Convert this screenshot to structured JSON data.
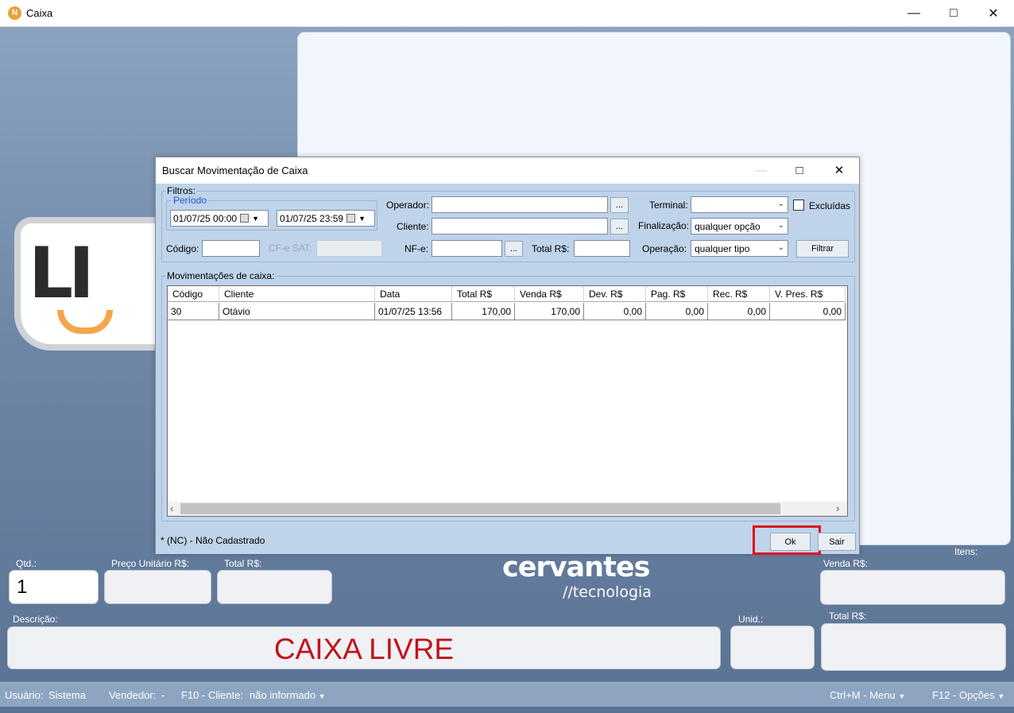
{
  "window": {
    "title": "Caixa",
    "app_icon_letter": "N"
  },
  "dialog": {
    "title": "Buscar Movimentação de Caixa",
    "filters_label": "Filtros:",
    "period_label": "Período",
    "date_from": "01/07/25 00:00",
    "date_to": "01/07/25 23:59",
    "operador_label": "Operador:",
    "operador_value": "",
    "cliente_label": "Cliente:",
    "cliente_value": "",
    "browse_label": "...",
    "terminal_label": "Terminal:",
    "terminal_value": "",
    "excluidas_label": "Excluídas",
    "finalizacao_label": "Finalização:",
    "finalizacao_value": "qualquer opção",
    "codigo_label": "Código:",
    "codigo_value": "",
    "cfe_sat_label": "CF-e SAT:",
    "nfe_label": "NF-e:",
    "total_label": "Total R$:",
    "operacao_label": "Operação:",
    "operacao_value": "qualquer tipo",
    "filtrar_label": "Filtrar",
    "movimentacoes_label": "Movimentações de caixa:",
    "columns": [
      "Código",
      "Cliente",
      "Data",
      "Total R$",
      "Venda R$",
      "Dev. R$",
      "Pag. R$",
      "Rec. R$",
      "V. Pres. R$"
    ],
    "rows": [
      [
        "30",
        "Otávio",
        "01/07/25 13:56",
        "170,00",
        "170,00",
        "0,00",
        "0,00",
        "0,00",
        "0,00"
      ]
    ],
    "footnote": "* (NC) - Não Cadastrado",
    "ok_label": "Ok",
    "sair_label": "Sair"
  },
  "pos": {
    "qtd_label": "Qtd.:",
    "qtd_value": "1",
    "preco_label": "Preço Unitário R$:",
    "total_label": "Total R$:",
    "brand_main": "cervantes",
    "brand_sub": "//tecnologia",
    "itens_label": "Itens:",
    "venda_label": "Venda R$:",
    "descricao_label": "Descrição:",
    "descricao_value": "CAIXA LIVRE",
    "unid_label": "Unid.:",
    "total2_label": "Total R$:",
    "logo_text": "LI"
  },
  "statusbar": {
    "usuario_label": "Usuário:",
    "usuario_value": "Sistema",
    "vendedor_label": "Vendedor:",
    "vendedor_value": "-",
    "cliente_label": "F10 - Cliente:",
    "cliente_value": "não informado",
    "menu_label": "Ctrl+M - Menu",
    "opcoes_label": "F12 - Opções"
  },
  "colors": {
    "highlight_border": "#e0101c",
    "descricao_text": "#c0141c",
    "accent_orange": "#f3a64a"
  }
}
